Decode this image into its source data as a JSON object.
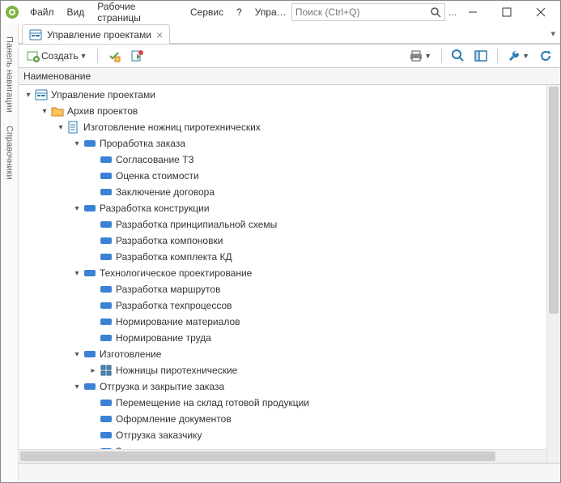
{
  "menu": {
    "file": "Файл",
    "view": "Вид",
    "pages": "Рабочие страницы",
    "service": "Сервис",
    "help": "?"
  },
  "breadcrumb": "Управ...",
  "search": {
    "placeholder": "Поиск (Ctrl+Q)",
    "dots": "..."
  },
  "side_tabs": {
    "nav": "Панель навигации",
    "refs": "Справочники"
  },
  "tab": {
    "title": "Управление проектами"
  },
  "toolbar": {
    "create": "Создать"
  },
  "grid": {
    "header": "Наименование"
  },
  "tree": {
    "root": "Управление проектами",
    "archive": "Архив проектов",
    "project": "Изготовление ножниц пиротехнических",
    "g1": "Проработка заказа",
    "g1_1": "Согласование ТЗ",
    "g1_2": "Оценка стоимости",
    "g1_3": "Заключение договора",
    "g2": "Разработка конструкции",
    "g2_1": "Разработка принципиальной схемы",
    "g2_2": "Разработка компоновки",
    "g2_3": "Разработка комплекта КД",
    "g3": "Технологическое проектирование",
    "g3_1": "Разработка маршрутов",
    "g3_2": "Разработка техпроцессов",
    "g3_3": "Нормирование материалов",
    "g3_4": "Нормирование труда",
    "g4": "Изготовление",
    "g4_1": "Ножницы пиротехнические",
    "g5": "Отгрузка и закрытие заказа",
    "g5_1": "Перемещение на склад готовой продукции",
    "g5_2": "Оформление документов",
    "g5_3": "Отгрузка заказчику",
    "g5_4": "Закрытие заказа"
  }
}
